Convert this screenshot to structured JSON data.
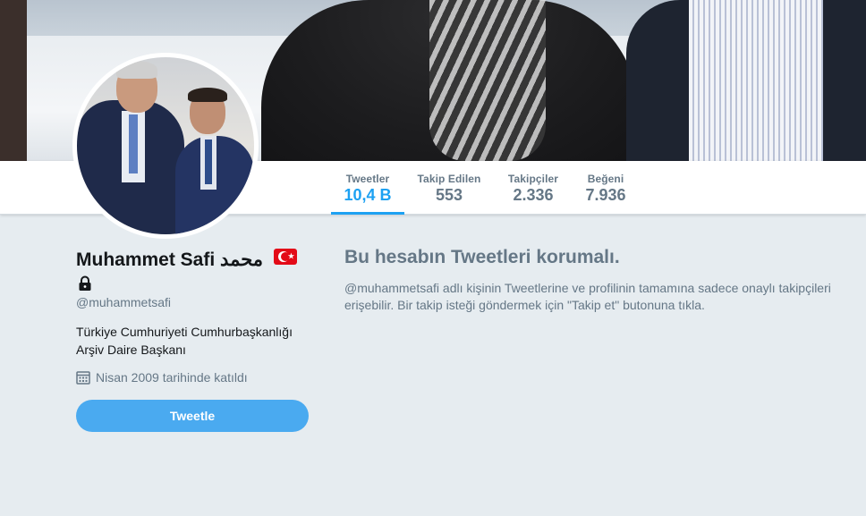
{
  "profile": {
    "name": "Muhammet Safi",
    "name_arabic": "محمد",
    "handle": "@muhammetsafi",
    "bio": "Türkiye Cumhuriyeti Cumhurbaşkanlığı Arşiv Daire Başkanı",
    "joined": "Nisan 2009 tarihinde katıldı",
    "flag_icon": "turkey-flag-icon",
    "lock_icon": "lock-icon",
    "calendar_icon": "calendar-icon"
  },
  "stats": [
    {
      "label": "Tweetler",
      "value": "10,4 B",
      "active": true
    },
    {
      "label": "Takip Edilen",
      "value": "553",
      "active": false
    },
    {
      "label": "Takipçiler",
      "value": "2.336",
      "active": false
    },
    {
      "label": "Beğeni",
      "value": "7.936",
      "active": false
    }
  ],
  "actions": {
    "tweet_label": "Tweetle"
  },
  "protected": {
    "title": "Bu hesabın Tweetleri korumalı.",
    "text": "@muhammetsafi adlı kişinin Tweetlerine ve profilinin tamamına sadece onaylı takipçileri erişebilir. Bir takip isteği göndermek için \"Takip et\" butonuna tıkla."
  },
  "colors": {
    "accent": "#1da1f2",
    "button": "#4aaaf0",
    "background": "#e6ecf0",
    "muted_text": "#657786"
  }
}
